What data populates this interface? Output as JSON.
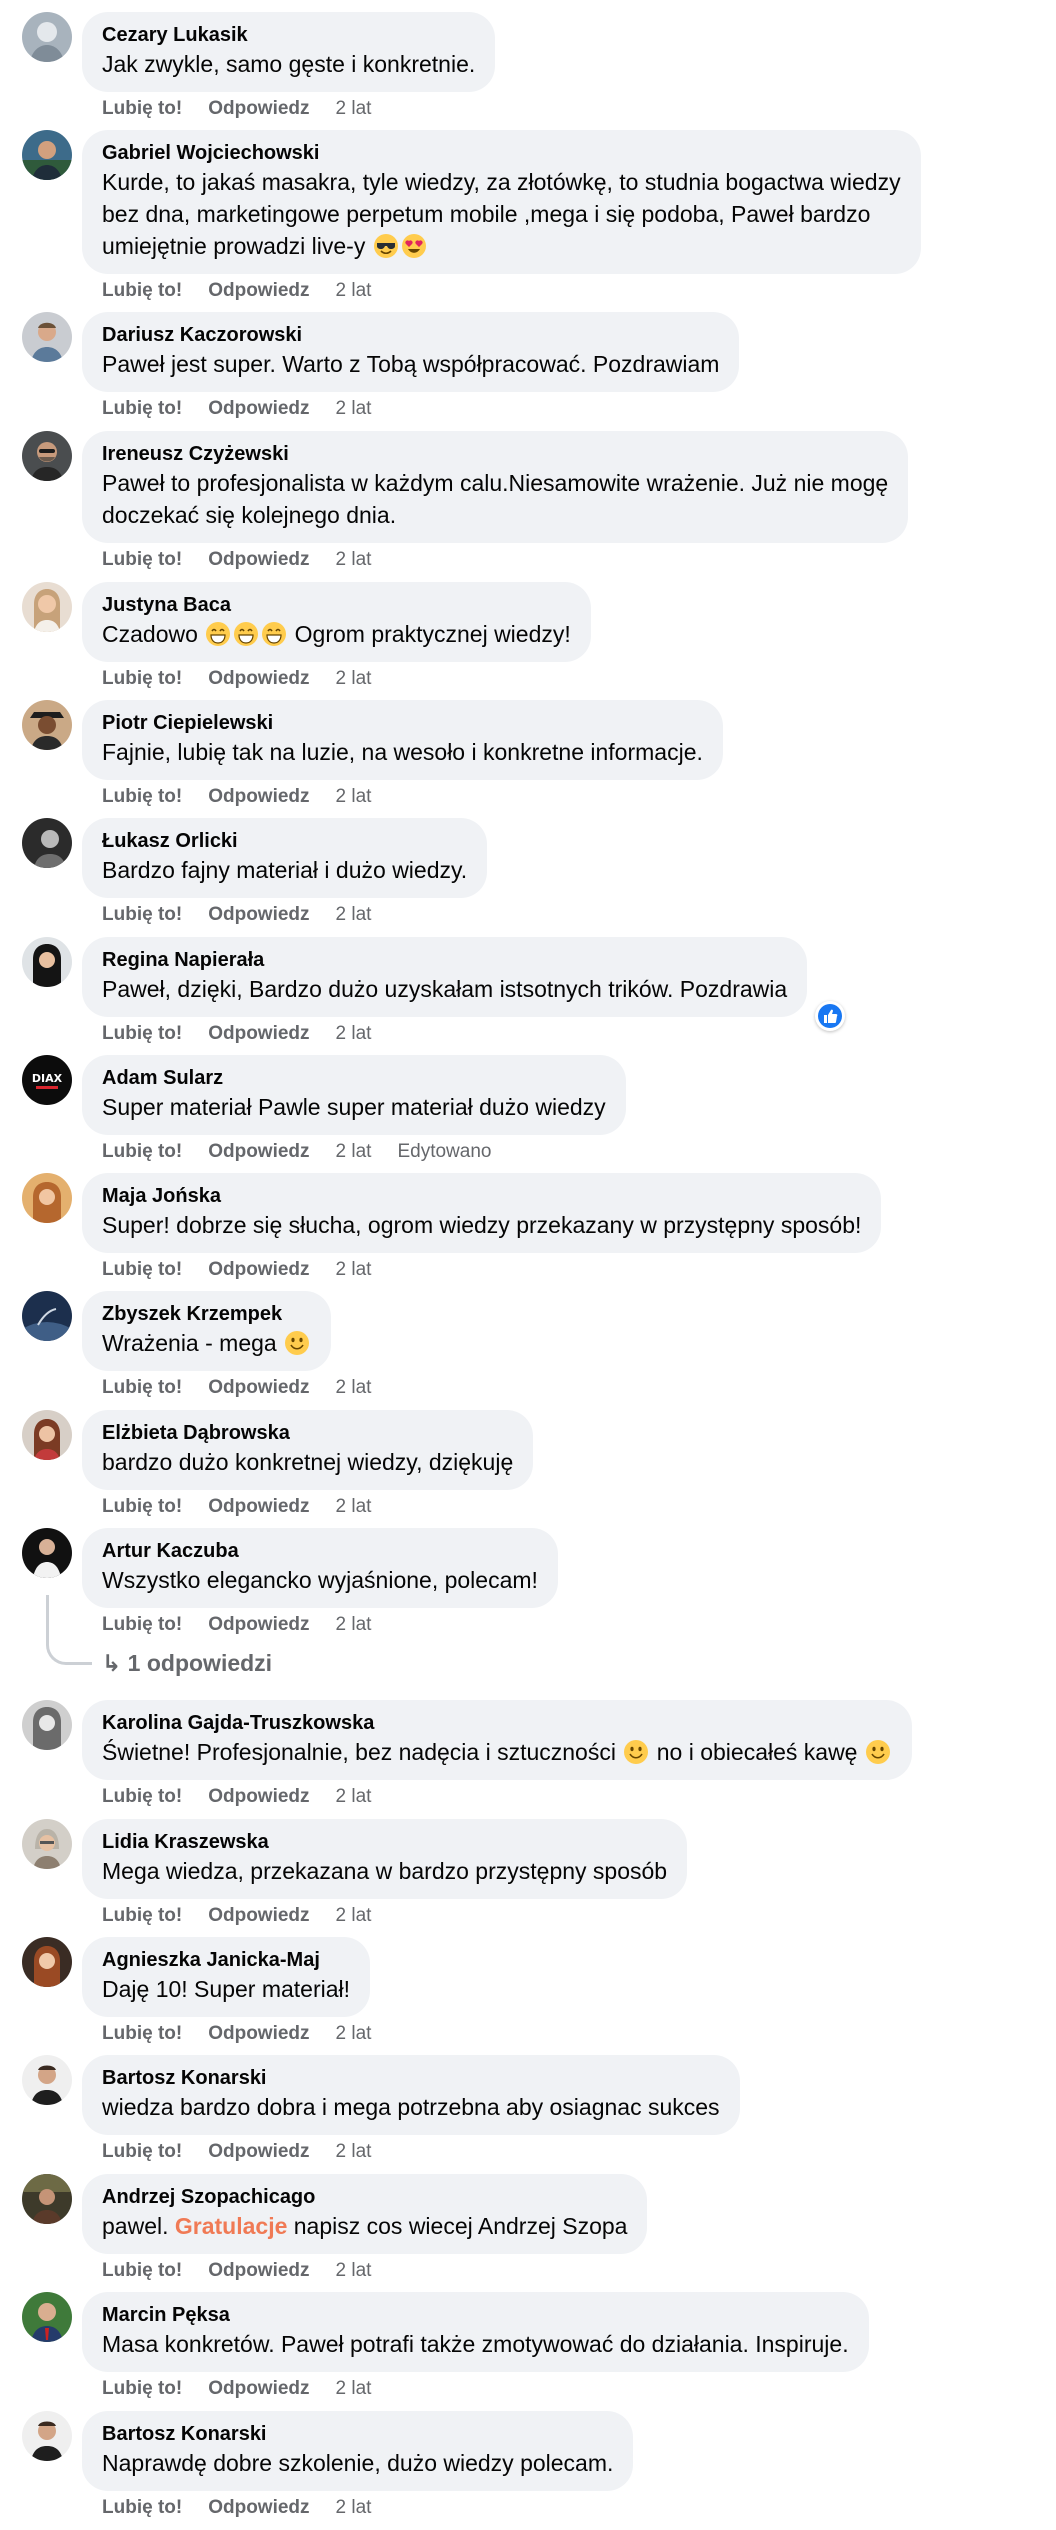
{
  "actions": {
    "like": "Lubię to!",
    "reply": "Odpowiedz",
    "time": "2 lat",
    "edited": "Edytowano"
  },
  "comments": [
    {
      "author": "Cezary Lukasik",
      "text": "Jak zwykle, samo gęste i konkretnie."
    },
    {
      "author": "Gabriel Wojciechowski",
      "lines": [
        "Kurde, to jakaś masakra, tyle wiedzy, za złotówkę, to studnia bogactwa wiedzy",
        "bez dna, marketingowe perpetum mobile ,mega i się podoba, Paweł bardzo",
        "umiejętnie prowadzi live-y"
      ]
    },
    {
      "author": "Dariusz Kaczorowski",
      "text": "Paweł jest super. Warto z Tobą współpracować. Pozdrawiam"
    },
    {
      "author": "Ireneusz Czyżewski",
      "lines": [
        "Paweł to profesjonalista w każdym calu.Niesamowite wrażenie. Już nie mogę",
        "doczekać się kolejnego dnia."
      ]
    },
    {
      "author": "Justyna Baca",
      "text_before": "Czadowo",
      "text_after": "Ogrom praktycznej wiedzy!"
    },
    {
      "author": "Piotr Ciepielewski",
      "text": "Fajnie, lubię tak na luzie, na wesoło i konkretne informacje."
    },
    {
      "author": "Łukasz Orlicki",
      "text": "Bardzo fajny materiał i dużo wiedzy."
    },
    {
      "author": "Regina Napierała",
      "text": "Paweł, dzięki, Bardzo dużo uzyskałam istsotnych trików. Pozdrawia"
    },
    {
      "author": "Adam Sularz",
      "text": "Super materiał Pawle super materiał dużo wiedzy",
      "avatar_label": "DIAX"
    },
    {
      "author": "Maja Jońska",
      "text": "Super! dobrze się słucha, ogrom wiedzy przekazany w przystępny sposób!"
    },
    {
      "author": "Zbyszek Krzempek",
      "text": "Wrażenia - mega"
    },
    {
      "author": "Elżbieta Dąbrowska",
      "text": "bardzo dużo konkretnej wiedzy, dziękuję"
    },
    {
      "author": "Artur Kaczuba",
      "text": "Wszystko elegancko wyjaśnione, polecam!",
      "replies_label": "1 odpowiedzi"
    },
    {
      "author": "Karolina Gajda-Truszkowska",
      "text_before": "Świetne! Profesjonalnie, bez nadęcia i sztuczności",
      "text_middle": "no i obiecałeś kawę"
    },
    {
      "author": "Lidia Kraszewska",
      "text": "Mega wiedza, przekazana w bardzo przystępny sposób"
    },
    {
      "author": "Agnieszka Janicka-Maj",
      "text": "Daję 10! Super materiał!"
    },
    {
      "author": "Bartosz Konarski",
      "text": "wiedza bardzo dobra i mega potrzebna aby osiagnac sukces"
    },
    {
      "author": "Andrzej Szopachicago",
      "text_before": "pawel.",
      "link": "Gratulacje",
      "text_after": "napisz cos wiecej Andrzej Szopa"
    },
    {
      "author": "Marcin Pęksa",
      "text": "Masa konkretów. Paweł potrafi także zmotywować do działania. Inspiruje."
    },
    {
      "author": "Bartosz Konarski",
      "text": "Naprawdę dobre szkolenie, dużo wiedzy polecam."
    }
  ]
}
